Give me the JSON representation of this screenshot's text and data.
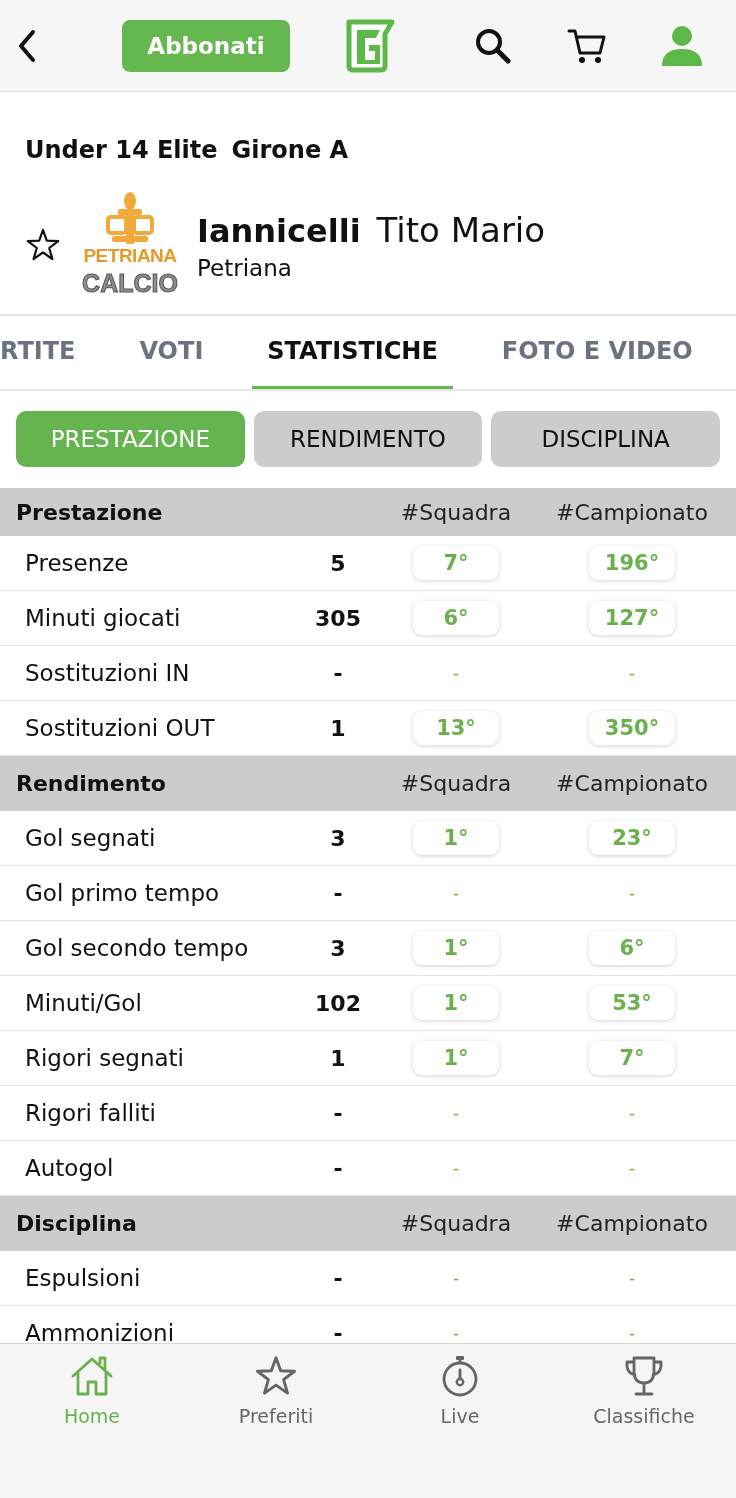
{
  "header": {
    "subscribe_button": "Abbonati"
  },
  "competition": {
    "name": "Under 14 Elite",
    "group": "Girone A"
  },
  "player": {
    "favorite": false,
    "surname": "Iannicelli",
    "given_names": "Tito Mario",
    "team": "Petriana",
    "club_logo": {
      "line_1": "PETRIANA",
      "line_2": "CALCIO"
    }
  },
  "tabs": [
    {
      "label": "RTITE",
      "selected": false
    },
    {
      "label": "VOTI",
      "selected": false
    },
    {
      "label": "STATISTICHE",
      "selected": true
    },
    {
      "label": "FOTO E VIDEO",
      "selected": false
    }
  ],
  "segments": [
    {
      "label": "PRESTAZIONE",
      "selected": true
    },
    {
      "label": "RENDIMENTO",
      "selected": false
    },
    {
      "label": "DISCIPLINA",
      "selected": false
    }
  ],
  "sections": [
    {
      "title": "Prestazione",
      "columns": [
        "#Squadra",
        "#Campionato"
      ],
      "rows": [
        {
          "label": "Presenze",
          "value": "5",
          "kind": "ranked",
          "team_rank": "7°",
          "league_rank": "196°"
        },
        {
          "label": "Minuti giocati",
          "value": "305",
          "kind": "ranked",
          "team_rank": "6°",
          "league_rank": "127°"
        },
        {
          "label": "Sostituzioni IN",
          "value": "-",
          "kind": "unranked",
          "team_rank": "-",
          "league_rank": "-"
        },
        {
          "label": "Sostituzioni OUT",
          "value": "1",
          "kind": "ranked",
          "team_rank": "13°",
          "league_rank": "350°"
        }
      ]
    },
    {
      "title": "Rendimento",
      "columns": [
        "#Squadra",
        "#Campionato"
      ],
      "rows": [
        {
          "label": "Gol segnati",
          "value": "3",
          "kind": "ranked",
          "team_rank": "1°",
          "league_rank": "23°"
        },
        {
          "label": "Gol primo tempo",
          "value": "-",
          "kind": "unranked",
          "team_rank": "-",
          "league_rank": "-"
        },
        {
          "label": "Gol secondo tempo",
          "value": "3",
          "kind": "ranked",
          "team_rank": "1°",
          "league_rank": "6°"
        },
        {
          "label": "Minuti/Gol",
          "value": "102",
          "kind": "ranked",
          "team_rank": "1°",
          "league_rank": "53°"
        },
        {
          "label": "Rigori segnati",
          "value": "1",
          "kind": "ranked",
          "team_rank": "1°",
          "league_rank": "7°"
        },
        {
          "label": "Rigori falliti",
          "value": "-",
          "kind": "unranked",
          "team_rank": "-",
          "league_rank": "-"
        },
        {
          "label": "Autogol",
          "value": "-",
          "kind": "unranked",
          "team_rank": "-",
          "league_rank": "-"
        }
      ]
    },
    {
      "title": "Disciplina",
      "columns": [
        "#Squadra",
        "#Campionato"
      ],
      "rows": [
        {
          "label": "Espulsioni",
          "value": "-",
          "kind": "unranked",
          "team_rank": "-",
          "league_rank": "-"
        },
        {
          "label": "Ammonizioni",
          "value": "-",
          "kind": "unranked",
          "team_rank": "-",
          "league_rank": "-"
        }
      ]
    }
  ],
  "bottom_nav": [
    {
      "label": "Home",
      "kind": "home",
      "selected": true
    },
    {
      "label": "Preferiti",
      "kind": "star",
      "selected": false
    },
    {
      "label": "Live",
      "kind": "stopwatch",
      "selected": false
    },
    {
      "label": "Classifiche",
      "kind": "trophy",
      "selected": false
    }
  ]
}
